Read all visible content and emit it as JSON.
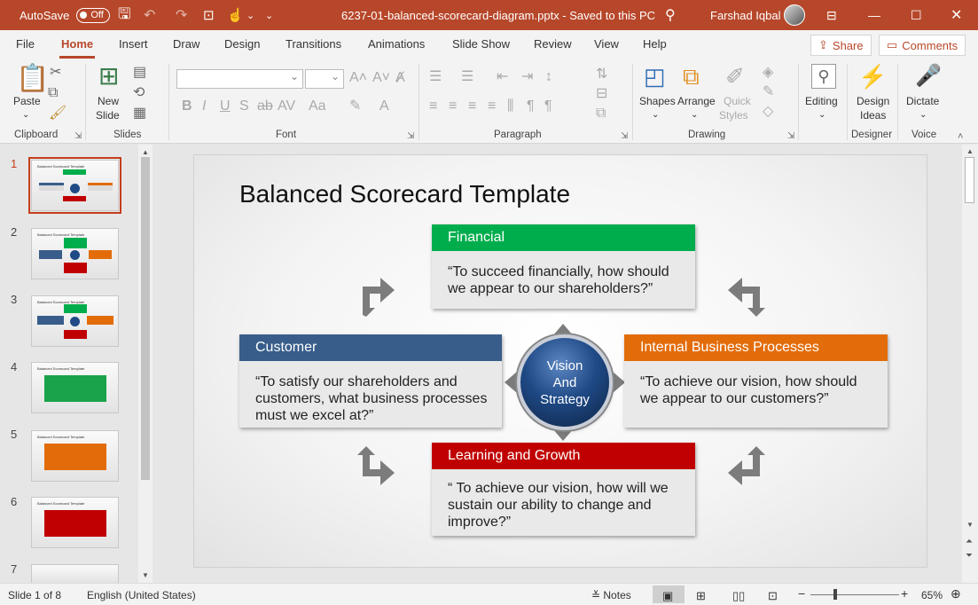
{
  "titlebar": {
    "autosave_label": "AutoSave",
    "autosave_state": "Off",
    "filename": "6237-01-balanced-scorecard-diagram.pptx  -  Saved to this PC",
    "user": "Farshad Iqbal",
    "bg_color": "#b7472a"
  },
  "tabs": [
    "File",
    "Home",
    "Insert",
    "Draw",
    "Design",
    "Transitions",
    "Animations",
    "Slide Show",
    "Review",
    "View",
    "Help"
  ],
  "share_label": "Share",
  "comments_label": "Comments",
  "ribbon": {
    "paste": "Paste",
    "new_slide_1": "New",
    "new_slide_2": "Slide",
    "shapes": "Shapes",
    "arrange": "Arrange",
    "quick_styles_1": "Quick",
    "quick_styles_2": "Styles",
    "editing": "Editing",
    "design_ideas_1": "Design",
    "design_ideas_2": "Ideas",
    "dictate": "Dictate",
    "groups": {
      "clipboard": "Clipboard",
      "slides": "Slides",
      "font": "Font",
      "paragraph": "Paragraph",
      "drawing": "Drawing",
      "designer": "Designer",
      "voice": "Voice"
    }
  },
  "thumbnails": [
    {
      "num": "1",
      "title": "Balanced Scorecard Template"
    },
    {
      "num": "2",
      "title": "Balanced Scorecard Template"
    },
    {
      "num": "3",
      "title": "Balanced Scorecard Template"
    },
    {
      "num": "4",
      "title": "Balanced Scorecard Template"
    },
    {
      "num": "5",
      "title": "Balanced Scorecard Template"
    },
    {
      "num": "6",
      "title": "Balanced Scorecard Template"
    },
    {
      "num": "7",
      "title": ""
    }
  ],
  "slide": {
    "title": "Balanced Scorecard Template",
    "financial": {
      "header": "Financial",
      "body": "“To succeed financially, how should we appear to our shareholders?”",
      "color": "#00ad4c"
    },
    "customer": {
      "header": "Customer",
      "body": "“To satisfy our shareholders and customers, what business processes must we excel at?”",
      "color": "#385d8a"
    },
    "internal": {
      "header": "Internal Business Processes",
      "body": "“To achieve our vision, how should we appear to our customers?”",
      "color": "#e36c0a"
    },
    "learning": {
      "header": "Learning and Growth",
      "body": "“ To achieve our vision, how will we sustain our ability to change and improve?”",
      "color": "#c00000"
    },
    "center": {
      "line1": "Vision",
      "line2": "And",
      "line3": "Strategy"
    }
  },
  "status": {
    "slide_info": "Slide 1 of 8",
    "language": "English (United States)",
    "notes": "Notes",
    "zoom": "65%"
  }
}
